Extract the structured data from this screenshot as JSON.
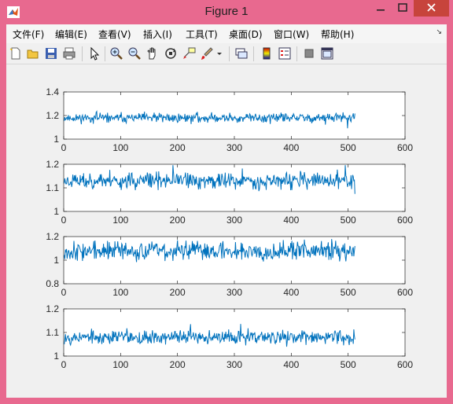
{
  "window": {
    "title": "Figure 1"
  },
  "menu": [
    "文件(F)",
    "编辑(E)",
    "查看(V)",
    "插入(I)",
    "工具(T)",
    "桌面(D)",
    "窗口(W)",
    "帮助(H)"
  ],
  "toolbar": [
    "new-figure-icon",
    "open-file-icon",
    "save-icon",
    "print-icon",
    "pointer-icon",
    "zoom-in-icon",
    "zoom-out-icon",
    "pan-icon",
    "rotate-3d-icon",
    "data-cursor-icon",
    "brush-icon",
    "link-plot-icon",
    "colorbar-icon",
    "legend-icon",
    "hide-plot-tools-icon",
    "show-plot-tools-icon"
  ],
  "colors": {
    "line": "#0072bd",
    "axes_bg": "#ffffff",
    "figure_bg": "#f0f0f0",
    "titlebar": "#e8698f",
    "close_button": "#c7443c"
  },
  "chart_data": [
    {
      "type": "line",
      "xlim": [
        0,
        600
      ],
      "ylim": [
        1,
        1.4
      ],
      "xticks": [
        "0",
        "100",
        "200",
        "300",
        "400",
        "500",
        "600"
      ],
      "yticks": [
        "1",
        "1.2",
        "1.4"
      ],
      "series": [
        {
          "n": 512,
          "mean": 1.18,
          "amp": 0.025,
          "seed": 11
        }
      ]
    },
    {
      "type": "line",
      "xlim": [
        0,
        600
      ],
      "ylim": [
        1,
        1.2
      ],
      "xticks": [
        "0",
        "100",
        "200",
        "300",
        "400",
        "500",
        "600"
      ],
      "yticks": [
        "1",
        "1.1",
        "1.2"
      ],
      "series": [
        {
          "n": 512,
          "mean": 1.13,
          "amp": 0.022,
          "seed": 23
        }
      ]
    },
    {
      "type": "line",
      "xlim": [
        0,
        600
      ],
      "ylim": [
        0.8,
        1.2
      ],
      "xticks": [
        "0",
        "100",
        "200",
        "300",
        "400",
        "500",
        "600"
      ],
      "yticks": [
        "0.8",
        "1",
        "1.2"
      ],
      "series": [
        {
          "n": 512,
          "mean": 1.08,
          "amp": 0.05,
          "seed": 37
        }
      ]
    },
    {
      "type": "line",
      "xlim": [
        0,
        600
      ],
      "ylim": [
        1,
        1.2
      ],
      "xticks": [
        "0",
        "100",
        "200",
        "300",
        "400",
        "500",
        "600"
      ],
      "yticks": [
        "1",
        "1.1",
        "1.2"
      ],
      "series": [
        {
          "n": 512,
          "mean": 1.08,
          "amp": 0.018,
          "seed": 53
        }
      ]
    }
  ]
}
